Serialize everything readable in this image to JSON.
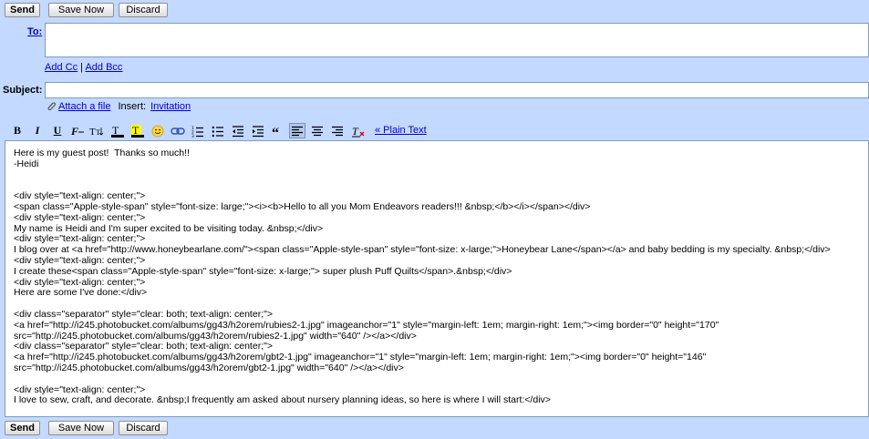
{
  "top_actions": {
    "send": "Send",
    "save": "Save Now",
    "discard": "Discard"
  },
  "bottom_actions": {
    "send": "Send",
    "save": "Save Now",
    "discard": "Discard"
  },
  "to": {
    "label": "To:",
    "value": ""
  },
  "cc_links": {
    "add_cc": "Add Cc",
    "separator": "|",
    "add_bcc": "Add Bcc"
  },
  "subject": {
    "label": "Subject:",
    "value": ""
  },
  "attach": {
    "label": "Attach a file",
    "insert_label": "Insert:",
    "invitation": "Invitation"
  },
  "toolbar": {
    "bold": "B",
    "italic": "I",
    "underline": "U",
    "plain_text": "« Plain Text"
  },
  "body_lines": [
    "Here is my guest post!  Thanks so much!!",
    "-Heidi",
    "",
    "",
    "<div style=\"text-align: center;\">",
    "<span class=\"Apple-style-span\" style=\"font-size: large;\"><i><b>Hello to all you Mom Endeavors readers!!! &nbsp;</b></i></span></div>",
    "<div style=\"text-align: center;\">",
    "My name is Heidi and I'm super excited to be visiting today. &nbsp;</div>",
    "<div style=\"text-align: center;\">",
    "I blog over at <a href=\"http://www.honeybearlane.com/\"><span class=\"Apple-style-span\" style=\"font-size: x-large;\">Honeybear Lane</span></a> and baby bedding is my specialty. &nbsp;</div>",
    "<div style=\"text-align: center;\">",
    "I create these<span class=\"Apple-style-span\" style=\"font-size: x-large;\"> super plush Puff Quilts</span>.&nbsp;</div>",
    "<div style=\"text-align: center;\">",
    "Here are some I've done:</div>",
    "",
    "<div class=\"separator\" style=\"clear: both; text-align: center;\">",
    "<a href=\"http://i245.photobucket.com/albums/gg43/h2orem/rubies2-1.jpg\" imageanchor=\"1\" style=\"margin-left: 1em; margin-right: 1em;\"><img border=\"0\" height=\"170\"",
    "src=\"http://i245.photobucket.com/albums/gg43/h2orem/rubies2-1.jpg\" width=\"640\" /></a></div>",
    "<div class=\"separator\" style=\"clear: both; text-align: center;\">",
    "<a href=\"http://i245.photobucket.com/albums/gg43/h2orem/gbt2-1.jpg\" imageanchor=\"1\" style=\"margin-left: 1em; margin-right: 1em;\"><img border=\"0\" height=\"146\"",
    "src=\"http://i245.photobucket.com/albums/gg43/h2orem/gbt2-1.jpg\" width=\"640\" /></a></div>",
    "",
    "<div style=\"text-align: center;\">",
    "I love to sew, craft, and decorate. &nbsp;I frequently am asked about nursery planning ideas, so here is where I will start:</div>"
  ],
  "colors": {
    "panel": "#c3d9ff",
    "link": "#0000cc",
    "field_border": "#7f9db9"
  }
}
